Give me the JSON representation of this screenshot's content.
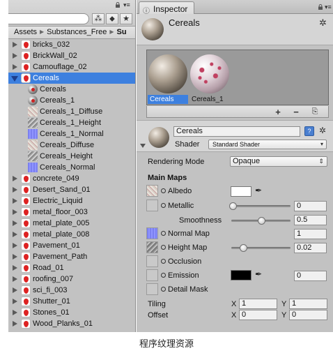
{
  "project": {
    "breadcrumb": [
      "Assets",
      "Substances_Free",
      "Su"
    ],
    "tree": [
      {
        "label": "bricks_032",
        "kind": "substance",
        "level": 0,
        "expanded": false
      },
      {
        "label": "BrickWall_02",
        "kind": "substance",
        "level": 0,
        "expanded": false
      },
      {
        "label": "Camouflage_02",
        "kind": "substance",
        "level": 0,
        "expanded": false
      },
      {
        "label": "Cereals",
        "kind": "substance",
        "level": 0,
        "expanded": true,
        "selected": true
      },
      {
        "label": "Cereals",
        "kind": "material",
        "level": 1
      },
      {
        "label": "Cereals_1",
        "kind": "material",
        "level": 1
      },
      {
        "label": "Cereals_1_Diffuse",
        "kind": "tex-diffuse",
        "level": 1
      },
      {
        "label": "Cereals_1_Height",
        "kind": "tex-height",
        "level": 1
      },
      {
        "label": "Cereals_1_Normal",
        "kind": "tex-normal",
        "level": 1
      },
      {
        "label": "Cereals_Diffuse",
        "kind": "tex-diffuse",
        "level": 1
      },
      {
        "label": "Cereals_Height",
        "kind": "tex-height",
        "level": 1
      },
      {
        "label": "Cereals_Normal",
        "kind": "tex-normal",
        "level": 1
      },
      {
        "label": "concrete_049",
        "kind": "substance",
        "level": 0,
        "expanded": false
      },
      {
        "label": "Desert_Sand_01",
        "kind": "substance",
        "level": 0,
        "expanded": false
      },
      {
        "label": "Electric_Liquid",
        "kind": "substance",
        "level": 0,
        "expanded": false
      },
      {
        "label": "metal_floor_003",
        "kind": "substance",
        "level": 0,
        "expanded": false
      },
      {
        "label": "metal_plate_005",
        "kind": "substance",
        "level": 0,
        "expanded": false
      },
      {
        "label": "metal_plate_008",
        "kind": "substance",
        "level": 0,
        "expanded": false
      },
      {
        "label": "Pavement_01",
        "kind": "substance",
        "level": 0,
        "expanded": false
      },
      {
        "label": "Pavement_Path",
        "kind": "substance",
        "level": 0,
        "expanded": false
      },
      {
        "label": "Road_01",
        "kind": "substance",
        "level": 0,
        "expanded": false
      },
      {
        "label": "roofing_007",
        "kind": "substance",
        "level": 0,
        "expanded": false
      },
      {
        "label": "sci_fi_003",
        "kind": "substance",
        "level": 0,
        "expanded": false
      },
      {
        "label": "Shutter_01",
        "kind": "substance",
        "level": 0,
        "expanded": false
      },
      {
        "label": "Stones_01",
        "kind": "substance",
        "level": 0,
        "expanded": false
      },
      {
        "label": "Wood_Planks_01",
        "kind": "substance",
        "level": 0,
        "expanded": false
      }
    ]
  },
  "inspector": {
    "tab_label": "Inspector",
    "object_title": "Cereals",
    "previews": [
      {
        "label": "Cereals",
        "selected": true
      },
      {
        "label": "Cereals_1",
        "selected": false
      }
    ],
    "preview_buttons": [
      "+",
      "−",
      "⎘"
    ],
    "material": {
      "name": "Cereals",
      "shader_label": "Shader",
      "shader_value": "Standard Shader"
    },
    "rendering_mode_label": "Rendering Mode",
    "rendering_mode_value": "Opaque",
    "main_maps_label": "Main Maps",
    "props": {
      "albedo": {
        "label": "Albedo",
        "color": "#ffffff"
      },
      "metallic": {
        "label": "Metallic",
        "value": "0",
        "level": 0
      },
      "smoothness": {
        "label": "Smoothness",
        "value": "0.5",
        "level": 0.5
      },
      "normal_map": {
        "label": "Normal Map",
        "value": "1"
      },
      "height_map": {
        "label": "Height Map",
        "value": "0.02",
        "level": 0.2
      },
      "occlusion": {
        "label": "Occlusion"
      },
      "emission": {
        "label": "Emission",
        "color": "#000000",
        "value": "0"
      },
      "detail_mask": {
        "label": "Detail Mask"
      }
    },
    "tiling": {
      "label": "Tiling",
      "x_label": "X",
      "x": "1",
      "y_label": "Y",
      "y": "1"
    },
    "offset": {
      "label": "Offset",
      "x_label": "X",
      "x": "0",
      "y_label": "Y",
      "y": "0"
    }
  },
  "caption": "程序纹理资源",
  "colors": {
    "selection": "#3d80df",
    "panel": "#c2c2c2"
  }
}
